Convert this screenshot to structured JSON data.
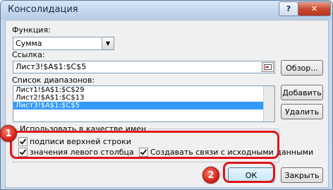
{
  "window": {
    "title": "Консолидация",
    "help_label": "?",
    "close_label": "✕"
  },
  "function": {
    "label": "Функция:",
    "value": "Сумма"
  },
  "reference": {
    "label": "Ссылка:",
    "value": "Лист3!$A$1:$C$5",
    "browse_label": "Обзор..."
  },
  "ranges": {
    "label": "Список диапазонов:",
    "items": [
      "Лист1!$A$1:$C$29",
      "Лист2!$A$1:$C$13",
      "Лист3!$A$1:$C$5"
    ],
    "selected_index": 2,
    "add_label": "Добавить",
    "delete_label": "Удалить"
  },
  "use_labels": {
    "legend": "Использовать в качестве имен",
    "top_row": {
      "label": "подписи верхней строки",
      "checked": true
    },
    "left_column": {
      "label": "значения левого столбца",
      "checked": true
    },
    "create_links": {
      "label": "Создавать связи с исходными данными",
      "checked": true
    }
  },
  "footer": {
    "ok_label": "ОК",
    "close_label": "Закрыть"
  },
  "annotations": {
    "badge_1": "1",
    "badge_2": "2",
    "highlight_color": "#e0141b"
  }
}
